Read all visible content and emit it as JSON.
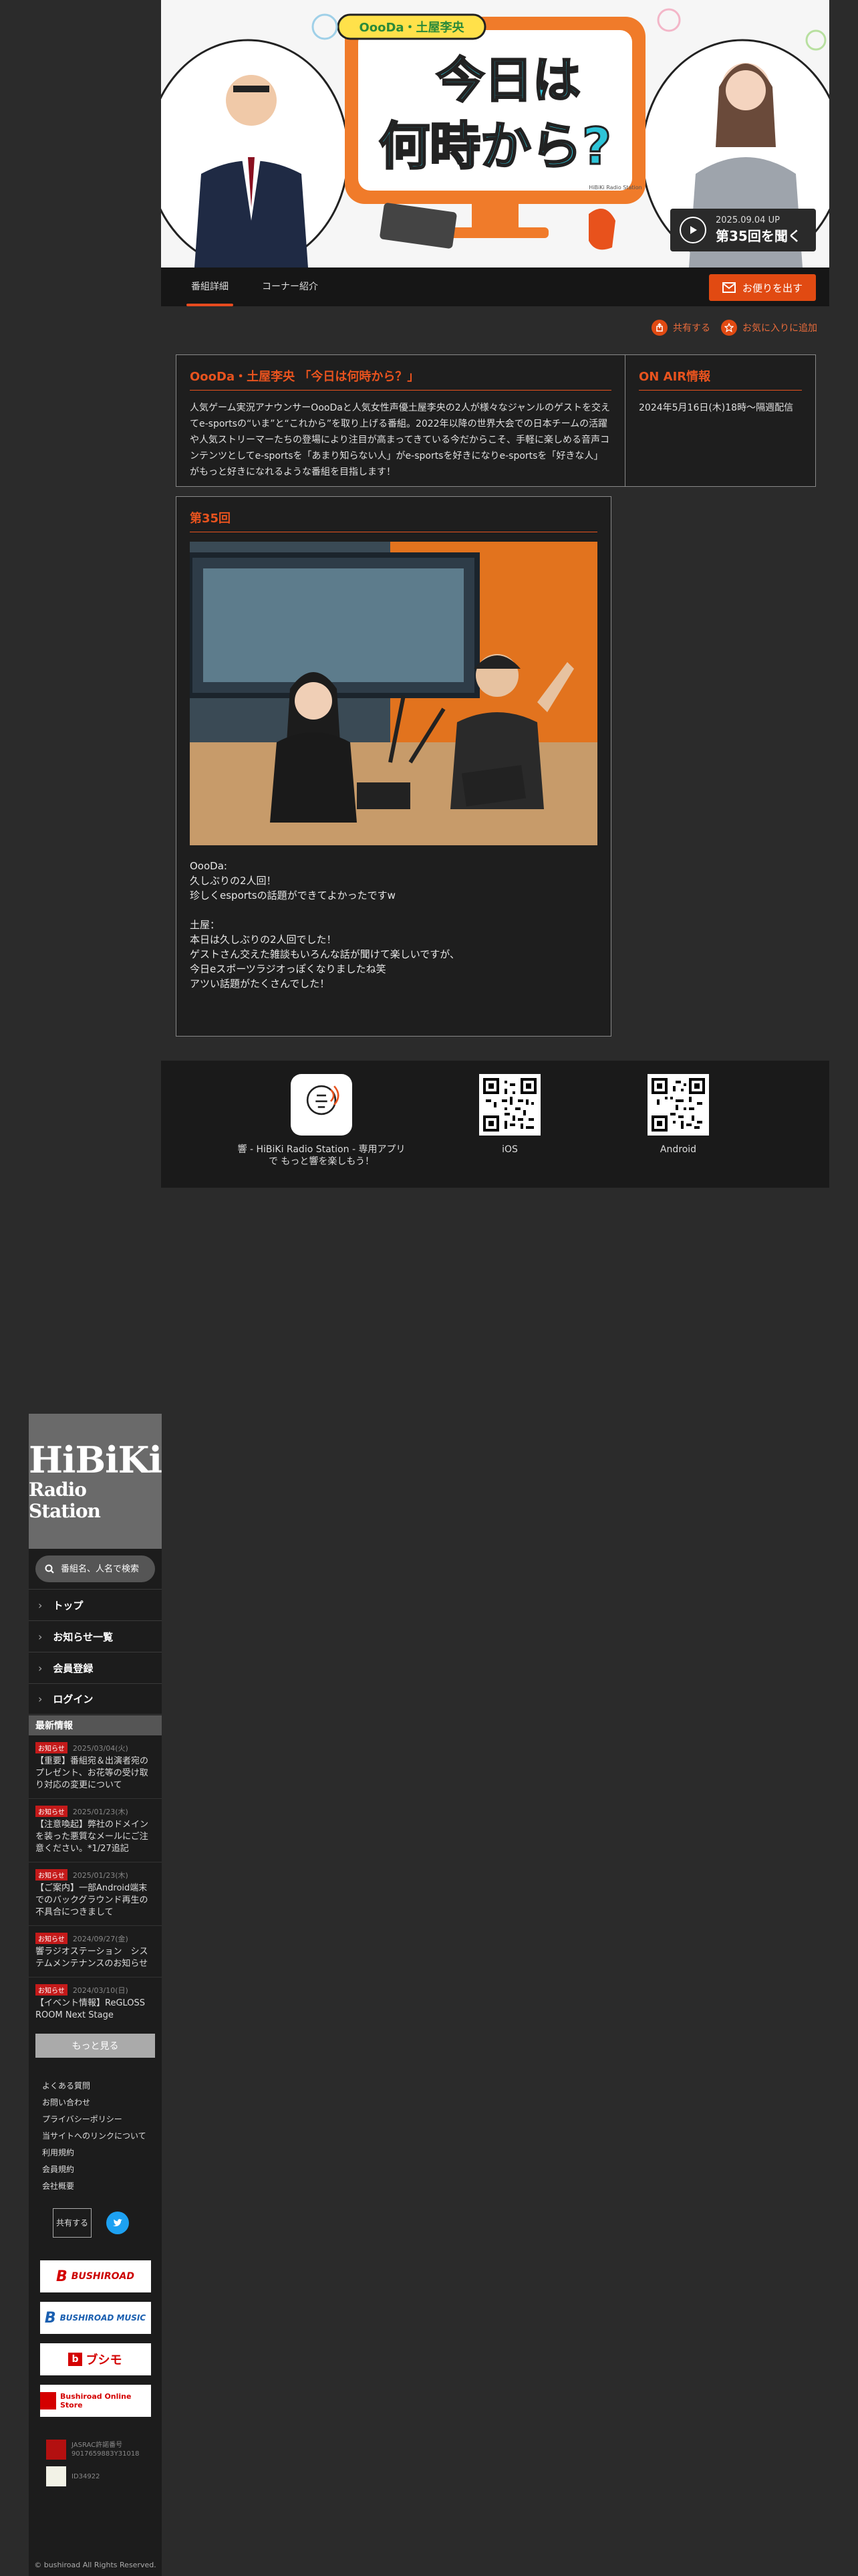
{
  "hero": {
    "brand_text": "HiBiKi Radio Station",
    "show_logo_top": "OooDa・土屋李央",
    "show_logo_main_1": "今日は",
    "show_logo_main_2": "何時から?",
    "date": "2025.09.04 UP",
    "play_label": "第35回を聞く"
  },
  "tabs": [
    {
      "label": "番組詳細"
    },
    {
      "label": "コーナー紹介"
    }
  ],
  "mail_button": "お便りを出す",
  "actions": {
    "share": "共有する",
    "favorite": "お気に入りに追加"
  },
  "program": {
    "title": "OooDa・土屋李央 「今日は何時から？」",
    "description": "人気ゲーム実況アナウンサーOooDaと人気女性声優土屋李央の2人が様々なジャンルのゲストを交えてe-sportsの“いま”と“これから”を取り上げる番組。2022年以降の世界大会での日本チームの活躍や人気ストリーマーたちの登場により注目が高まってきている今だからこそ、手軽に楽しめる音声コンテンツとしてe-sportsを「あまり知らない人」がe-sportsを好きになりe-sportsを「好きな人」がもっと好きになれるような番組を目指します！"
  },
  "onair": {
    "title": "ON AIR情報",
    "text": "2024年5月16日(木)18時〜隔週配信"
  },
  "episode": {
    "title": "第35回",
    "text": "OooDa:\n久しぶりの2人回！\n珍しくesportsの話題ができてよかったですw\n\n土屋：\n本日は久しぶりの2人回でした！\nゲストさん交えた雑談もいろんな話が聞けて楽しいですが、\n今日eスポーツラジオっぽくなりましたね笑\nアツい話題がたくさんでした！"
  },
  "app_footer": {
    "app_caption": "響 - HiBiKi Radio Station - 専用アプリで もっと響を楽しもう！",
    "app_icon_text": "HiBiKi Radio Station",
    "ios": "iOS",
    "android": "Android"
  },
  "sidebar": {
    "logo_main": "HiBiKi",
    "logo_sub": "Radio Station",
    "search_placeholder": "番組名、人名で検索",
    "nav": [
      {
        "label": "トップ"
      },
      {
        "label": "お知らせ一覧"
      },
      {
        "label": "会員登録"
      },
      {
        "label": "ログイン"
      }
    ],
    "news_heading": "最新情報",
    "news": [
      {
        "badge": "お知らせ",
        "date": "2025/03/04(火)",
        "title": "【重要】番組宛＆出演者宛のプレゼント、お花等の受け取り対応の変更について"
      },
      {
        "badge": "お知らせ",
        "date": "2025/01/23(木)",
        "title": "【注意喚起】弊社のドメインを装った悪質なメールにご注意ください。*1/27追記"
      },
      {
        "badge": "お知らせ",
        "date": "2025/01/23(木)",
        "title": "【ご案内】一部Android端末でのバックグラウンド再生の不具合につきまして"
      },
      {
        "badge": "お知らせ",
        "date": "2024/09/27(金)",
        "title": "響ラジオステーション　システムメンテナンスのお知らせ"
      },
      {
        "badge": "お知らせ",
        "date": "2024/03/10(日)",
        "title": "【イベント情報】ReGLOSS ROOM Next Stage"
      }
    ],
    "more": "もっと見る",
    "links": [
      "よくある質問",
      "お問い合わせ",
      "プライバシーポリシー",
      "当サイトへのリンクについて",
      "利用規約",
      "会員規約",
      "会社概要"
    ],
    "share": "共有する",
    "banners": [
      "BUSHIROAD",
      "BUSHIROAD MUSIC",
      "ブシモ",
      "Bushiroad Online Store"
    ],
    "license_1": "JASRAC許諾番号 9017659883Y31018",
    "license_2": "ID34922",
    "copyright": "© bushiroad All Rights Reserved."
  },
  "colors": {
    "accent": "#e14a12",
    "bg": "#2b2b2b",
    "panel": "#1e1e1e"
  }
}
